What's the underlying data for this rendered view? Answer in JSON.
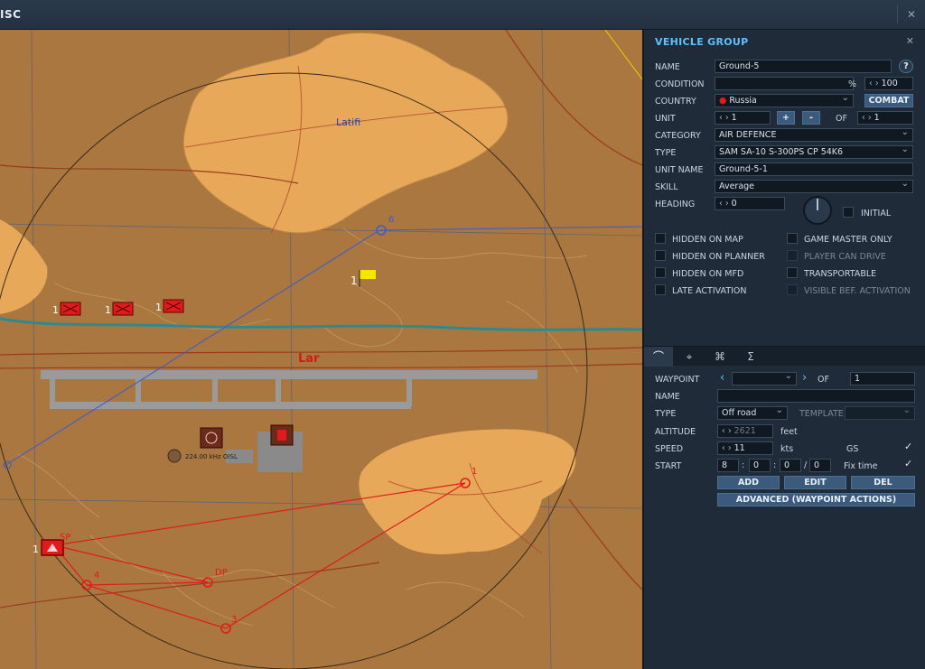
{
  "window": {
    "title": "ISC",
    "close": "✕"
  },
  "map": {
    "town_name": "Latifi",
    "airfield_name": "Lar",
    "radio_label": "224.00 kHz OISL",
    "wp6": "6",
    "ground_units": [
      "1",
      "1",
      "1"
    ],
    "flag_count": "1",
    "route": {
      "sp_count": "1",
      "sp": "SP",
      "wp1": "1",
      "wp3": "3",
      "wp4": "4",
      "dp": "DP"
    }
  },
  "panel": {
    "title": "VEHICLE GROUP",
    "close": "✕",
    "name_label": "NAME",
    "name_value": "Ground-5",
    "help": "?",
    "condition_label": "CONDITION",
    "condition_value": "",
    "percent": "%",
    "probability": "100",
    "country_label": "COUNTRY",
    "country_value": "Russia",
    "combat_label": "COMBAT",
    "unit_label": "UNIT",
    "unit_value": "1",
    "plus": "+",
    "minus": "-",
    "of_label": "OF",
    "unit_total": "1",
    "category_label": "CATEGORY",
    "category_value": "AIR DEFENCE",
    "type_label": "TYPE",
    "type_value": "SAM SA-10 S-300PS CP 54K6",
    "unit_name_label": "UNIT NAME",
    "unit_name_value": "Ground-5-1",
    "skill_label": "SKILL",
    "skill_value": "Average",
    "heading_label": "HEADING",
    "heading_value": "0",
    "initial_label": "INITIAL",
    "checkboxes": {
      "hidden_on_map": "HIDDEN ON MAP",
      "hidden_on_planner": "HIDDEN ON PLANNER",
      "hidden_on_mfd": "HIDDEN ON MFD",
      "late_activation": "LATE ACTIVATION",
      "game_master_only": "GAME MASTER ONLY",
      "player_can_drive": "PLAYER CAN DRIVE",
      "transportable": "TRANSPORTABLE",
      "visible_bef_activation": "VISIBLE BEF. ACTIVATION"
    },
    "waypoint": {
      "waypoint_label": "WAYPOINT",
      "waypoint_value": "",
      "of_label": "OF",
      "of_value": "1",
      "name_label": "NAME",
      "name_value": "",
      "type_label": "TYPE",
      "type_value": "Off road",
      "template_label": "TEMPLATE",
      "template_value": "",
      "altitude_label": "ALTITUDE",
      "altitude_value": "2621",
      "altitude_unit": "feet",
      "speed_label": "SPEED",
      "speed_value": "11",
      "speed_unit": "kts",
      "gs_label": "GS",
      "start_label": "START",
      "start_d": "8",
      "start_h": "0",
      "start_m": "0",
      "start_s": "0",
      "colon": ":",
      "slash": "/",
      "fix_time_label": "Fix time",
      "add": "ADD",
      "edit": "EDIT",
      "del": "DEL",
      "advanced": "ADVANCED (WAYPOINT ACTIONS)"
    }
  },
  "colors": {
    "accent": "#5fc1ff",
    "map_ground": "#a9773f",
    "town": "#e8a85a",
    "route": "#e01b1b",
    "blue_route": "#3a5bd1"
  }
}
